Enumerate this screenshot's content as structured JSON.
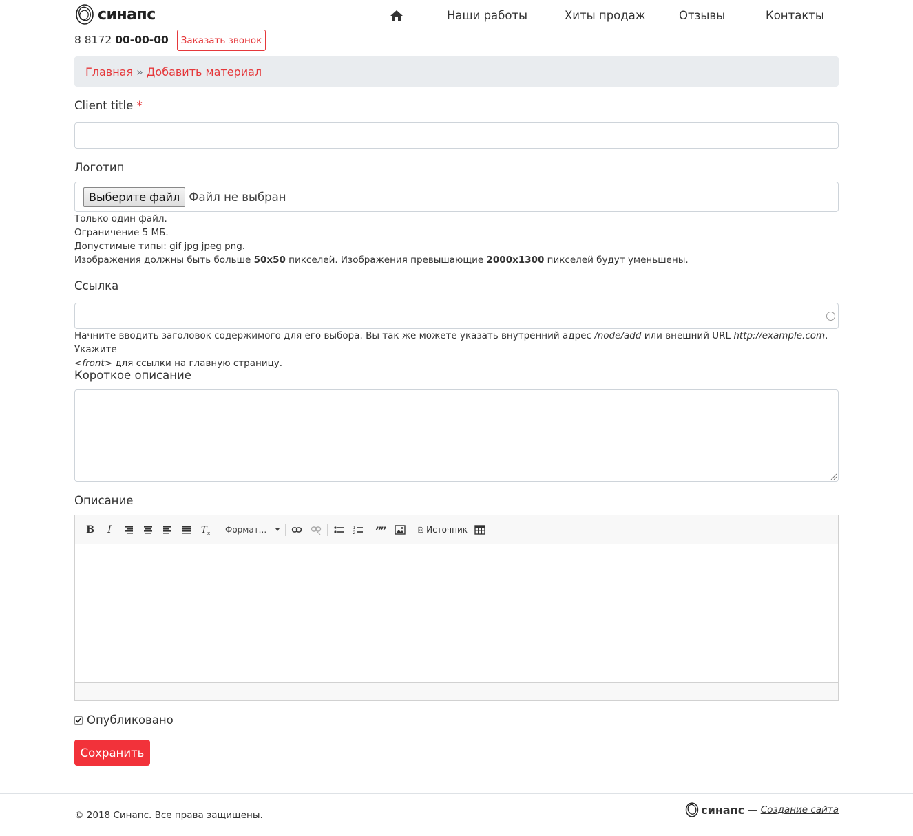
{
  "header": {
    "logo_text": "синапс",
    "phone_code": "8 8172",
    "phone_number": "00-00-00",
    "callback_label": "Заказать звонок",
    "nav": [
      {
        "label": "Наши работы"
      },
      {
        "label": "Хиты продаж"
      },
      {
        "label": "Отзывы"
      },
      {
        "label": "Контакты"
      }
    ]
  },
  "breadcrumb": {
    "home": "Главная",
    "separator": "»",
    "current": "Добавить материал"
  },
  "form": {
    "client_title": {
      "label": "Client title",
      "required_mark": "*",
      "value": ""
    },
    "logo": {
      "label": "Логотип",
      "button_label": "Выберите файл",
      "status": "Файл не выбран",
      "help": {
        "line1": "Только один файл.",
        "line2": "Ограничение 5 МБ.",
        "line3": "Допустимые типы: gif jpg jpeg png.",
        "line4_a": "Изображения должны быть больше",
        "line4_b": "50x50",
        "line4_c": "пикселей. Изображения превышающие",
        "line4_d": "2000x1300",
        "line4_e": "пикселей будут уменьшены."
      }
    },
    "link": {
      "label": "Ссылка",
      "value": "",
      "help": {
        "a": "Начните вводить заголовок содержимого для его выбора. Вы так же можете указать внутренний адрес",
        "b": "/node/add",
        "c": "или внешний URL",
        "d": "http://example.com",
        "e": ". Укажите",
        "f": "<front>",
        "g": "для ссылки на главную страницу."
      }
    },
    "short_description": {
      "label": "Короткое описание",
      "value": ""
    },
    "description": {
      "label": "Описание",
      "toolbar": {
        "bold": "B",
        "italic": "I",
        "format_label": "Формат...",
        "source_label": "Источник"
      }
    },
    "published": {
      "label": "Опубликовано",
      "checked": true
    },
    "save_label": "Сохранить"
  },
  "footer": {
    "copyright": "© 2018 Синапс. Все права защищены.",
    "brand_text": "синапс",
    "dash": "—",
    "link_label": "Создание сайта"
  },
  "colors": {
    "accent": "#e5383b",
    "button": "#f2323a",
    "breadcrumb_bg": "#e9ecef"
  }
}
